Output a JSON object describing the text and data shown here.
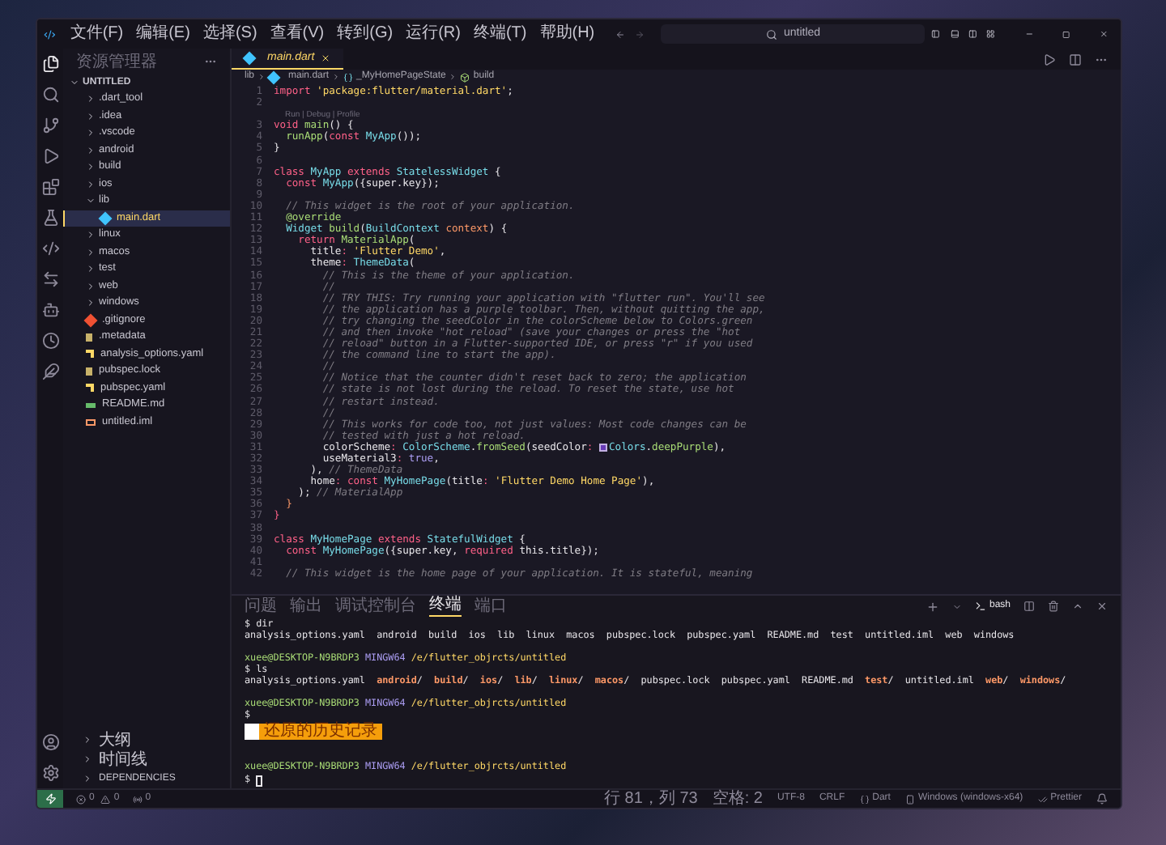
{
  "menu": [
    "文件(F)",
    "编辑(E)",
    "选择(S)",
    "查看(V)",
    "转到(G)",
    "运行(R)",
    "终端(T)",
    "帮助(H)"
  ],
  "search": {
    "value": "untitled"
  },
  "sidebar": {
    "title": "资源管理器",
    "folder": "UNTITLED",
    "items": [
      {
        "name": ".dart_tool",
        "kind": "folder",
        "expanded": false,
        "selected": false
      },
      {
        "name": ".idea",
        "kind": "folder",
        "expanded": false,
        "selected": false
      },
      {
        "name": ".vscode",
        "kind": "folder",
        "expanded": false,
        "selected": false
      },
      {
        "name": "android",
        "kind": "folder",
        "expanded": false,
        "selected": false
      },
      {
        "name": "build",
        "kind": "folder",
        "expanded": false,
        "selected": false
      },
      {
        "name": "ios",
        "kind": "folder",
        "expanded": false,
        "selected": false
      },
      {
        "name": "lib",
        "kind": "folder",
        "expanded": true,
        "selected": false,
        "children": [
          {
            "name": "main.dart",
            "kind": "dart",
            "selected": true
          }
        ]
      },
      {
        "name": "linux",
        "kind": "folder",
        "expanded": false,
        "selected": false
      },
      {
        "name": "macos",
        "kind": "folder",
        "expanded": false,
        "selected": false
      },
      {
        "name": "test",
        "kind": "folder",
        "expanded": false,
        "selected": false
      },
      {
        "name": "web",
        "kind": "folder",
        "expanded": false,
        "selected": false
      },
      {
        "name": "windows",
        "kind": "folder",
        "expanded": false,
        "selected": false
      },
      {
        "name": ".gitignore",
        "kind": "git",
        "selected": false
      },
      {
        "name": ".metadata",
        "kind": "meta",
        "selected": false
      },
      {
        "name": "analysis_options.yaml",
        "kind": "yaml",
        "selected": false
      },
      {
        "name": "pubspec.lock",
        "kind": "meta",
        "selected": false
      },
      {
        "name": "pubspec.yaml",
        "kind": "yaml",
        "selected": false
      },
      {
        "name": "README.md",
        "kind": "md",
        "selected": false
      },
      {
        "name": "untitled.iml",
        "kind": "iml",
        "selected": false
      }
    ],
    "sections": [
      {
        "label": "大纲",
        "expanded": false
      },
      {
        "label": "时间线",
        "expanded": false
      },
      {
        "label": "DEPENDENCIES",
        "expanded": false
      }
    ]
  },
  "editor_tabs": [
    {
      "label": "main.dart",
      "selected": true
    }
  ],
  "breadcrumbs": [
    "lib",
    "main.dart",
    "_MyHomePageState",
    "build"
  ],
  "code": [
    {
      "n": "1",
      "t": [
        {
          "text": "import ",
          "kind": "kw"
        },
        {
          "text": "'package:flutter/material.dart'",
          "kind": "str"
        },
        {
          "text": ";",
          "kind": "p"
        }
      ]
    },
    {
      "n": "2"
    },
    {
      "n": "3",
      "lens": "Run | Debug | Profile",
      "t": [
        {
          "text": "void ",
          "kind": "kw"
        },
        {
          "text": "main",
          "kind": "fn"
        },
        {
          "text": "() {",
          "kind": "p"
        }
      ]
    },
    {
      "n": "4",
      "t": [
        {
          "text": "  runApp",
          "kind": "fn"
        },
        {
          "text": "(",
          "kind": "p"
        },
        {
          "text": "const ",
          "kind": "kw"
        },
        {
          "text": "MyApp",
          "kind": "type"
        },
        {
          "text": "());",
          "kind": "p"
        }
      ]
    },
    {
      "n": "5",
      "t": [
        {
          "text": "}",
          "kind": "p"
        }
      ]
    },
    {
      "n": "6"
    },
    {
      "n": "7",
      "t": [
        {
          "text": "class ",
          "kind": "kw"
        },
        {
          "text": "MyApp ",
          "kind": "type"
        },
        {
          "text": "extends ",
          "kind": "kw"
        },
        {
          "text": "StatelessWidget ",
          "kind": "type"
        },
        {
          "text": "{",
          "kind": "p"
        }
      ]
    },
    {
      "n": "8",
      "t": [
        {
          "text": "  const ",
          "kind": "kw"
        },
        {
          "text": "MyApp",
          "kind": "type"
        },
        {
          "text": "({super.key});",
          "kind": "p"
        }
      ]
    },
    {
      "n": "9"
    },
    {
      "n": "10",
      "t": [
        {
          "text": "  // This widget is the root of your application.",
          "kind": "cmt"
        }
      ]
    },
    {
      "n": "11",
      "t": [
        {
          "text": "  @override",
          "kind": "fn"
        }
      ]
    },
    {
      "n": "12",
      "t": [
        {
          "text": "  Widget ",
          "kind": "type"
        },
        {
          "text": "build",
          "kind": "fn"
        },
        {
          "text": "(",
          "kind": "p"
        },
        {
          "text": "BuildContext ",
          "kind": "type"
        },
        {
          "text": "context",
          "kind": "param"
        },
        {
          "text": ") {",
          "kind": "p"
        }
      ]
    },
    {
      "n": "13",
      "t": [
        {
          "text": "    return ",
          "kind": "kw"
        },
        {
          "text": "MaterialApp",
          "kind": "fn"
        },
        {
          "text": "(",
          "kind": "p"
        }
      ]
    },
    {
      "n": "14",
      "t": [
        {
          "text": "      title",
          "kind": "p"
        },
        {
          "text": ": ",
          "kind": "kw"
        },
        {
          "text": "'Flutter Demo'",
          "kind": "str"
        },
        {
          "text": ",",
          "kind": "p"
        }
      ]
    },
    {
      "n": "15",
      "t": [
        {
          "text": "      theme",
          "kind": "p"
        },
        {
          "text": ": ",
          "kind": "kw"
        },
        {
          "text": "ThemeData",
          "kind": "type"
        },
        {
          "text": "(",
          "kind": "p"
        }
      ]
    },
    {
      "n": "16",
      "t": [
        {
          "text": "        // This is the theme of your application.",
          "kind": "cmt"
        }
      ]
    },
    {
      "n": "17",
      "t": [
        {
          "text": "        //",
          "kind": "cmt"
        }
      ]
    },
    {
      "n": "18",
      "t": [
        {
          "text": "        // TRY THIS: Try running your application with \"flutter run\". You'll see",
          "kind": "cmt"
        }
      ]
    },
    {
      "n": "19",
      "t": [
        {
          "text": "        // the application has a purple toolbar. Then, without quitting the app,",
          "kind": "cmt"
        }
      ]
    },
    {
      "n": "20",
      "t": [
        {
          "text": "        // try changing the seedColor in the colorScheme below to Colors.green",
          "kind": "cmt"
        }
      ]
    },
    {
      "n": "21",
      "t": [
        {
          "text": "        // and then invoke \"hot reload\" (save your changes or press the \"hot",
          "kind": "cmt"
        }
      ]
    },
    {
      "n": "22",
      "t": [
        {
          "text": "        // reload\" button in a Flutter-supported IDE, or press \"r\" if you used",
          "kind": "cmt"
        }
      ]
    },
    {
      "n": "23",
      "t": [
        {
          "text": "        // the command line to start the app).",
          "kind": "cmt"
        }
      ]
    },
    {
      "n": "24",
      "t": [
        {
          "text": "        //",
          "kind": "cmt"
        }
      ]
    },
    {
      "n": "25",
      "t": [
        {
          "text": "        // Notice that the counter didn't reset back to zero; the application",
          "kind": "cmt"
        }
      ]
    },
    {
      "n": "26",
      "t": [
        {
          "text": "        // state is not lost during the reload. To reset the state, use hot",
          "kind": "cmt"
        }
      ]
    },
    {
      "n": "27",
      "t": [
        {
          "text": "        // restart instead.",
          "kind": "cmt"
        }
      ]
    },
    {
      "n": "28",
      "t": [
        {
          "text": "        //",
          "kind": "cmt"
        }
      ]
    },
    {
      "n": "29",
      "t": [
        {
          "text": "        // This works for code too, not just values: Most code changes can be",
          "kind": "cmt"
        }
      ]
    },
    {
      "n": "30",
      "t": [
        {
          "text": "        // tested with just a hot reload.",
          "kind": "cmt"
        }
      ]
    },
    {
      "n": "31",
      "t": [
        {
          "text": "        colorScheme",
          "kind": "p"
        },
        {
          "text": ": ",
          "kind": "kw"
        },
        {
          "text": "ColorScheme",
          "kind": "type"
        },
        {
          "text": ".",
          "kind": "p"
        },
        {
          "text": "fromSeed",
          "kind": "fn"
        },
        {
          "text": "(seedColor",
          "kind": "p"
        },
        {
          "text": ": ",
          "kind": "kw"
        },
        {
          "text": "Colors",
          "kind": "swatch"
        },
        {
          "text": ".",
          "kind": "p"
        },
        {
          "text": "deepPurple",
          "kind": "fn"
        },
        {
          "text": "),",
          "kind": "p"
        }
      ]
    },
    {
      "n": "32",
      "t": [
        {
          "text": "        useMaterial3",
          "kind": "p"
        },
        {
          "text": ": ",
          "kind": "kw"
        },
        {
          "text": "true",
          "kind": "num"
        },
        {
          "text": ",",
          "kind": "p"
        }
      ]
    },
    {
      "n": "33",
      "t": [
        {
          "text": "      ), ",
          "kind": "p"
        },
        {
          "text": "// ThemeData",
          "kind": "cmt"
        }
      ]
    },
    {
      "n": "34",
      "t": [
        {
          "text": "      home",
          "kind": "p"
        },
        {
          "text": ": ",
          "kind": "kw"
        },
        {
          "text": "const ",
          "kind": "kw"
        },
        {
          "text": "MyHomePage",
          "kind": "type"
        },
        {
          "text": "(title",
          "kind": "p"
        },
        {
          "text": ": ",
          "kind": "kw"
        },
        {
          "text": "'Flutter Demo Home Page'",
          "kind": "str"
        },
        {
          "text": "),",
          "kind": "p"
        }
      ]
    },
    {
      "n": "35",
      "t": [
        {
          "text": "    ); ",
          "kind": "p"
        },
        {
          "text": "// MaterialApp",
          "kind": "cmt"
        }
      ]
    },
    {
      "n": "36",
      "t": [
        {
          "text": "  }",
          "kind": "param"
        }
      ]
    },
    {
      "n": "37",
      "t": [
        {
          "text": "}",
          "kind": "kw"
        }
      ]
    },
    {
      "n": "38"
    },
    {
      "n": "39",
      "t": [
        {
          "text": "class ",
          "kind": "kw"
        },
        {
          "text": "MyHomePage ",
          "kind": "type"
        },
        {
          "text": "extends ",
          "kind": "kw"
        },
        {
          "text": "StatefulWidget ",
          "kind": "type"
        },
        {
          "text": "{",
          "kind": "p"
        }
      ]
    },
    {
      "n": "40",
      "t": [
        {
          "text": "  const ",
          "kind": "kw"
        },
        {
          "text": "MyHomePage",
          "kind": "type"
        },
        {
          "text": "({super.key, ",
          "kind": "p"
        },
        {
          "text": "required ",
          "kind": "kw"
        },
        {
          "text": "this.title});",
          "kind": "p"
        }
      ]
    },
    {
      "n": "41"
    },
    {
      "n": "42",
      "t": [
        {
          "text": "  // This widget is the home page of your application. It is stateful, meaning",
          "kind": "cmt"
        }
      ]
    }
  ],
  "panel_tabs": [
    {
      "label": "问题",
      "selected": false
    },
    {
      "label": "输出",
      "selected": false
    },
    {
      "label": "调试控制台",
      "selected": false
    },
    {
      "label": "终端",
      "selected": true
    },
    {
      "label": "端口",
      "selected": false
    }
  ],
  "terminal_shell": "bash",
  "terminal": [
    {
      "kind": "text",
      "t": [
        {
          "text": "$ dir",
          "kind": "p"
        }
      ]
    },
    {
      "kind": "text",
      "t": [
        {
          "text": "analysis_options.yaml  android  build  ios  lib  linux  macos  pubspec.lock  pubspec.yaml  README.md  test  untitled.iml  web  windows",
          "kind": "p"
        }
      ]
    },
    {
      "kind": "blank"
    },
    {
      "kind": "text",
      "t": [
        {
          "text": "xuee@DESKTOP-N9BRDP3 ",
          "kind": "user"
        },
        {
          "text": "MINGW64 ",
          "kind": "host"
        },
        {
          "text": "/e/flutter_objrcts/untitled",
          "kind": "path"
        }
      ]
    },
    {
      "kind": "text",
      "t": [
        {
          "text": "$ ls",
          "kind": "p"
        }
      ]
    },
    {
      "kind": "text",
      "t": [
        {
          "text": "analysis_options.yaml  ",
          "kind": "p"
        },
        {
          "text": "android",
          "kind": "dir"
        },
        {
          "text": "/  ",
          "kind": "p"
        },
        {
          "text": "build",
          "kind": "dir"
        },
        {
          "text": "/  ",
          "kind": "p"
        },
        {
          "text": "ios",
          "kind": "dir"
        },
        {
          "text": "/  ",
          "kind": "p"
        },
        {
          "text": "lib",
          "kind": "dir"
        },
        {
          "text": "/  ",
          "kind": "p"
        },
        {
          "text": "linux",
          "kind": "dir"
        },
        {
          "text": "/  ",
          "kind": "p"
        },
        {
          "text": "macos",
          "kind": "dir"
        },
        {
          "text": "/  pubspec.lock  pubspec.yaml  README.md  ",
          "kind": "p"
        },
        {
          "text": "test",
          "kind": "dir"
        },
        {
          "text": "/  untitled.iml  ",
          "kind": "p"
        },
        {
          "text": "web",
          "kind": "dir"
        },
        {
          "text": "/  ",
          "kind": "p"
        },
        {
          "text": "windows",
          "kind": "dir"
        },
        {
          "text": "/",
          "kind": "p"
        }
      ]
    },
    {
      "kind": "blank"
    },
    {
      "kind": "text",
      "t": [
        {
          "text": "xuee@DESKTOP-N9BRDP3 ",
          "kind": "user"
        },
        {
          "text": "MINGW64 ",
          "kind": "host"
        },
        {
          "text": "/e/flutter_objrcts/untitled",
          "kind": "path"
        }
      ]
    },
    {
      "kind": "text",
      "t": [
        {
          "text": "$",
          "kind": "p"
        }
      ]
    },
    {
      "kind": "history",
      "text": "还原的历史记录"
    },
    {
      "kind": "blank"
    },
    {
      "kind": "blank"
    },
    {
      "kind": "text",
      "t": [
        {
          "text": "xuee@DESKTOP-N9BRDP3 ",
          "kind": "user"
        },
        {
          "text": "MINGW64 ",
          "kind": "host"
        },
        {
          "text": "/e/flutter_objrcts/untitled",
          "kind": "path"
        }
      ]
    },
    {
      "kind": "prompt",
      "text": "$"
    }
  ],
  "status": {
    "errors": "0",
    "warnings": "0",
    "ports": "0",
    "right": [
      {
        "label": "行 81，列 73",
        "kind": "text"
      },
      {
        "label": "空格: 2",
        "kind": "text"
      },
      {
        "label": "UTF-8",
        "kind": "text"
      },
      {
        "label": "CRLF",
        "kind": "text"
      },
      {
        "label": "Dart",
        "kind": "lang"
      },
      {
        "label": "Windows (windows-x64)",
        "kind": "device"
      },
      {
        "label": "Prettier",
        "kind": "check"
      }
    ]
  }
}
